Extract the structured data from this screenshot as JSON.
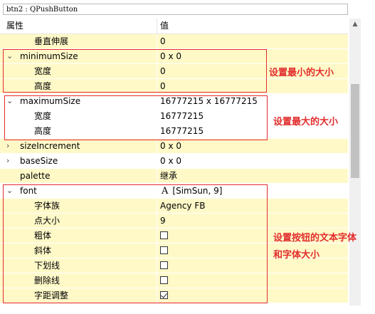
{
  "window": {
    "title": "btn2 : QPushButton"
  },
  "header": {
    "col_property": "属性",
    "col_value": "值"
  },
  "rows": [
    {
      "name": "垂直伸展",
      "value": "0"
    },
    {
      "name": "minimumSize",
      "value": "0 x 0",
      "expanded": true
    },
    {
      "name": "宽度",
      "value": "0"
    },
    {
      "name": "高度",
      "value": "0"
    },
    {
      "name": "maximumSize",
      "value": "16777215 x 16777215",
      "expanded": true
    },
    {
      "name": "宽度",
      "value": "16777215"
    },
    {
      "name": "高度",
      "value": "16777215"
    },
    {
      "name": "sizeIncrement",
      "value": "0 x 0",
      "expanded": false
    },
    {
      "name": "baseSize",
      "value": "0 x 0",
      "expanded": false
    },
    {
      "name": "palette",
      "value": "继承"
    },
    {
      "name": "font",
      "value": "[SimSun, 9]",
      "expanded": true
    },
    {
      "name": "字体族",
      "value": "Agency FB"
    },
    {
      "name": "点大小",
      "value": "9"
    },
    {
      "name": "粗体",
      "checked": false
    },
    {
      "name": "斜体",
      "checked": false
    },
    {
      "name": "下划线",
      "checked": false
    },
    {
      "name": "删除线",
      "checked": false
    },
    {
      "name": "字距调整",
      "checked": true
    }
  ],
  "annotations": {
    "min_size": "设置最小的大小",
    "max_size": "设置最大的大小",
    "font_line1": "设置按钮的文本字体",
    "font_line2": "和字体大小"
  },
  "font_icon_glyph": "A",
  "colors": {
    "annotation": "#e22c2c",
    "row_yellow": "#fff9c8",
    "scroll_thumb": "#c1c1c1"
  }
}
